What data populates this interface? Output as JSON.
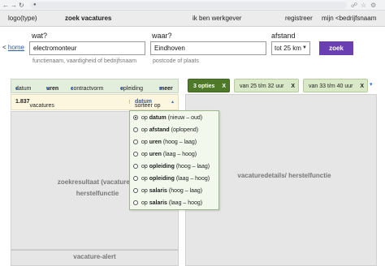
{
  "browser": {
    "back_icon": "←",
    "forward_icon": "→",
    "reload_icon": "↻",
    "lock_icon": "●",
    "icons": [
      "share-icon",
      "star-icon",
      "extensions-icon"
    ]
  },
  "header": {
    "logo": "logo(type)",
    "nav_vacatures": "zoek vacatures",
    "nav_werkgever": "ik ben werkgever",
    "nav_registreer": "registreer",
    "nav_bedrijfsnaam": "mijn <bedrijfsnaam"
  },
  "search": {
    "back_prefix": "<",
    "back_link": "home",
    "wat_label": "wat?",
    "wat_value": "electromonteur",
    "wat_hint": "functienaam, vaardigheid of bedrijfsnaam",
    "waar_label": "waar?",
    "waar_value": "Eindhoven",
    "waar_hint": "postcode of plaats",
    "afstand_label": "afstand",
    "afstand_value": "tot 25 km",
    "zoek_label": "zoek"
  },
  "filters": {
    "items": [
      {
        "label": "datum",
        "arrow": "▾",
        "bold": false
      },
      {
        "label": "uren",
        "arrow": "▾",
        "bold": true
      },
      {
        "label": "contractvorm",
        "arrow": "▾",
        "bold": false
      },
      {
        "label": "opleiding",
        "arrow": "▾",
        "bold": false
      },
      {
        "label": "meer",
        "arrow": "▾",
        "bold": true
      }
    ]
  },
  "results": {
    "count": "1.837",
    "count_suffix": "vacatures",
    "info_icon": "!",
    "sort_prefix": "sorteer op",
    "sort_value": "datum",
    "sort_caret": "▴",
    "pane_text": "zoekresultaat (vacatures)/ herstelfunctie",
    "alert_text": "vacature-alert"
  },
  "active_filters": {
    "opties": "3 opties",
    "chip_1": "van 25 t/m 32 uur",
    "chip_2": "van 33 t/m 40 uur",
    "remove": "X",
    "more_arrow": "▾"
  },
  "details": {
    "pane_text": "vacaturedetails/ herstelfunctie"
  },
  "sort_menu": {
    "options": [
      {
        "prefix": "op",
        "key": "datum",
        "suffix": "(nieuw – oud)",
        "selected": true
      },
      {
        "prefix": "op",
        "key": "afstand",
        "suffix": "(oplopend)",
        "selected": false
      },
      {
        "prefix": "op",
        "key": "uren",
        "suffix": "(hoog – laag)",
        "selected": false
      },
      {
        "prefix": "op",
        "key": "uren",
        "suffix": "(laag – hoog)",
        "selected": false
      },
      {
        "prefix": "op",
        "key": "opleiding",
        "suffix": "(hoog – laag)",
        "selected": false
      },
      {
        "prefix": "op",
        "key": "opleiding",
        "suffix": "(laag – hoog)",
        "selected": false
      },
      {
        "prefix": "op",
        "key": "salaris",
        "suffix": "(hoog – laag)",
        "selected": false
      },
      {
        "prefix": "op",
        "key": "salaris",
        "suffix": "(laag – hoog)",
        "selected": false
      }
    ]
  },
  "colors": {
    "accent": "#6a3fb2",
    "chip_dark": "#4e7a2a",
    "chip_light": "#d9e9c8",
    "filter_bar": "#e4eedc",
    "count_bar": "#fdf6df"
  }
}
